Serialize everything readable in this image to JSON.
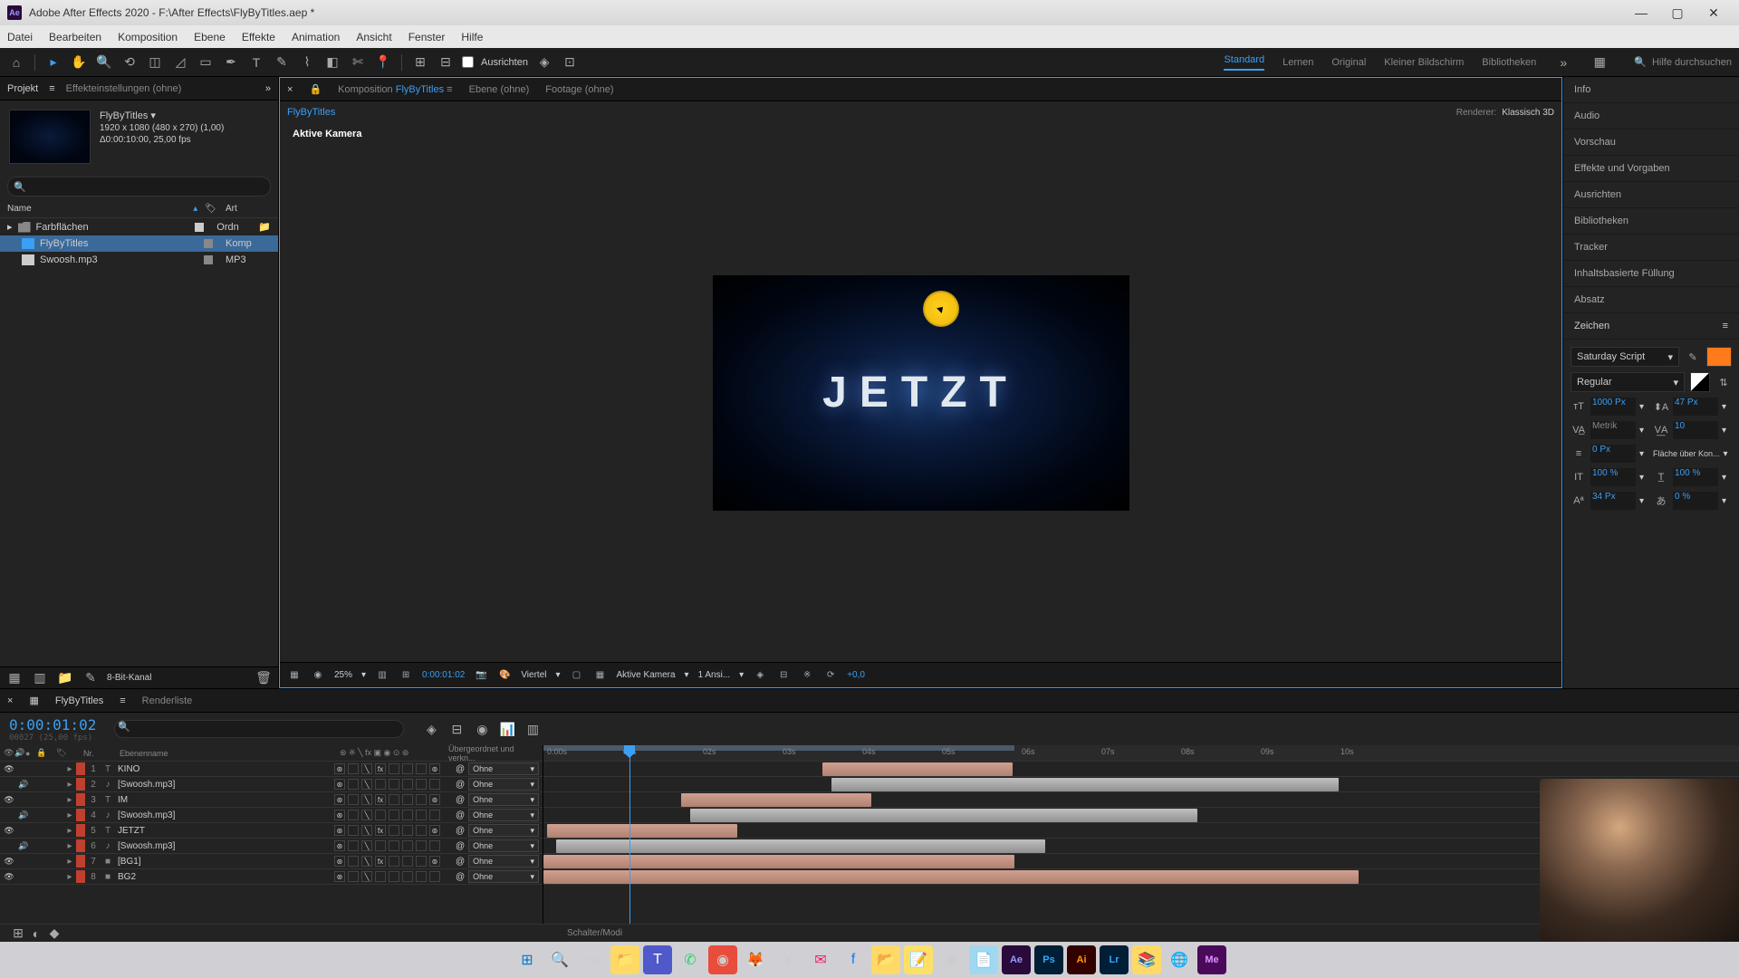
{
  "titlebar": {
    "app_icon": "Ae",
    "title": "Adobe After Effects 2020 - F:\\After Effects\\FlyByTitles.aep *"
  },
  "menubar": [
    "Datei",
    "Bearbeiten",
    "Komposition",
    "Ebene",
    "Effekte",
    "Animation",
    "Ansicht",
    "Fenster",
    "Hilfe"
  ],
  "toolbar": {
    "ausrichten": "Ausrichten",
    "workspaces": [
      "Standard",
      "Lernen",
      "Original",
      "Kleiner Bildschirm",
      "Bibliotheken"
    ],
    "active_workspace": "Standard",
    "search_placeholder": "Hilfe durchsuchen"
  },
  "project_panel": {
    "tabs": {
      "projekt": "Projekt",
      "effekte": "Effekteinstellungen  (ohne)"
    },
    "comp_name": "FlyByTitles ▾",
    "comp_info1": "1920 x 1080 (480 x 270) (1,00)",
    "comp_info2": "Δ0:00:10:00, 25,00 fps",
    "cols": {
      "name": "Name",
      "art": "Art"
    },
    "items": [
      {
        "name": "Farbflächen",
        "type": "Ordn",
        "kind": "folder"
      },
      {
        "name": "FlyByTitles",
        "type": "Komp",
        "kind": "comp",
        "selected": true
      },
      {
        "name": "Swoosh.mp3",
        "type": "MP3",
        "kind": "audio"
      }
    ],
    "footer": {
      "bit": "8-Bit-Kanal"
    }
  },
  "comp_panel": {
    "tabs": {
      "komposition": "Komposition",
      "komposition_link": "FlyByTitles",
      "ebene": "Ebene  (ohne)",
      "footage": "Footage  (ohne)"
    },
    "crumb": "FlyByTitles",
    "renderer_label": "Renderer:",
    "renderer_value": "Klassisch 3D",
    "active_camera": "Aktive Kamera",
    "preview_text": "JETZT",
    "footer": {
      "zoom": "25%",
      "time": "0:00:01:02",
      "res": "Viertel",
      "view": "Aktive Kamera",
      "views": "1 Ansi...",
      "exposure": "+0,0"
    }
  },
  "right_panels": {
    "items": [
      "Info",
      "Audio",
      "Vorschau",
      "Effekte und Vorgaben",
      "Ausrichten",
      "Bibliotheken",
      "Tracker",
      "Inhaltsbasierte Füllung",
      "Absatz"
    ],
    "zeichen_header": "Zeichen",
    "font": "Saturday Script",
    "weight": "Regular",
    "size": "1000 Px",
    "leading": "47 Px",
    "kerning": "Metrik",
    "tracking": "10",
    "stroke": "0 Px",
    "stroke_mode": "Fläche über Kon...",
    "vscale": "100 %",
    "hscale": "100 %",
    "baseline": "34 Px",
    "tsume": "0 %"
  },
  "timeline": {
    "tabs": {
      "comp": "FlyByTitles",
      "render": "Renderliste"
    },
    "time": "0:00:01:02",
    "time_sub": "00027 (25,00 fps)",
    "cols": {
      "nr": "Nr.",
      "name": "Ebenenname",
      "parent": "Übergeordnet und verkn..."
    },
    "layers": [
      {
        "num": 1,
        "name": "KINO",
        "type": "T",
        "color": "#c04030",
        "parent": "Ohne",
        "vis": true,
        "threed": true
      },
      {
        "num": 2,
        "name": "[Swoosh.mp3]",
        "type": "A",
        "color": "#c04030",
        "parent": "Ohne",
        "audio": true
      },
      {
        "num": 3,
        "name": "IM",
        "type": "T",
        "color": "#c04030",
        "parent": "Ohne",
        "vis": true,
        "threed": true
      },
      {
        "num": 4,
        "name": "[Swoosh.mp3]",
        "type": "A",
        "color": "#c04030",
        "parent": "Ohne",
        "audio": true
      },
      {
        "num": 5,
        "name": "JETZT",
        "type": "T",
        "color": "#c04030",
        "parent": "Ohne",
        "vis": true,
        "threed": true
      },
      {
        "num": 6,
        "name": "[Swoosh.mp3]",
        "type": "A",
        "color": "#c04030",
        "parent": "Ohne",
        "audio": true
      },
      {
        "num": 7,
        "name": "[BG1]",
        "type": "S",
        "color": "#c04030",
        "parent": "Ohne",
        "vis": true,
        "threed": true
      },
      {
        "num": 8,
        "name": "BG2",
        "type": "S",
        "color": "#c04030",
        "parent": "Ohne",
        "vis": true
      }
    ],
    "ruler_ticks": [
      "0:00s",
      "01s",
      "02s",
      "03s",
      "04s",
      "05s",
      "06s",
      "07s",
      "08s",
      "09s",
      "10s"
    ],
    "footer": "Schalter/Modi"
  }
}
